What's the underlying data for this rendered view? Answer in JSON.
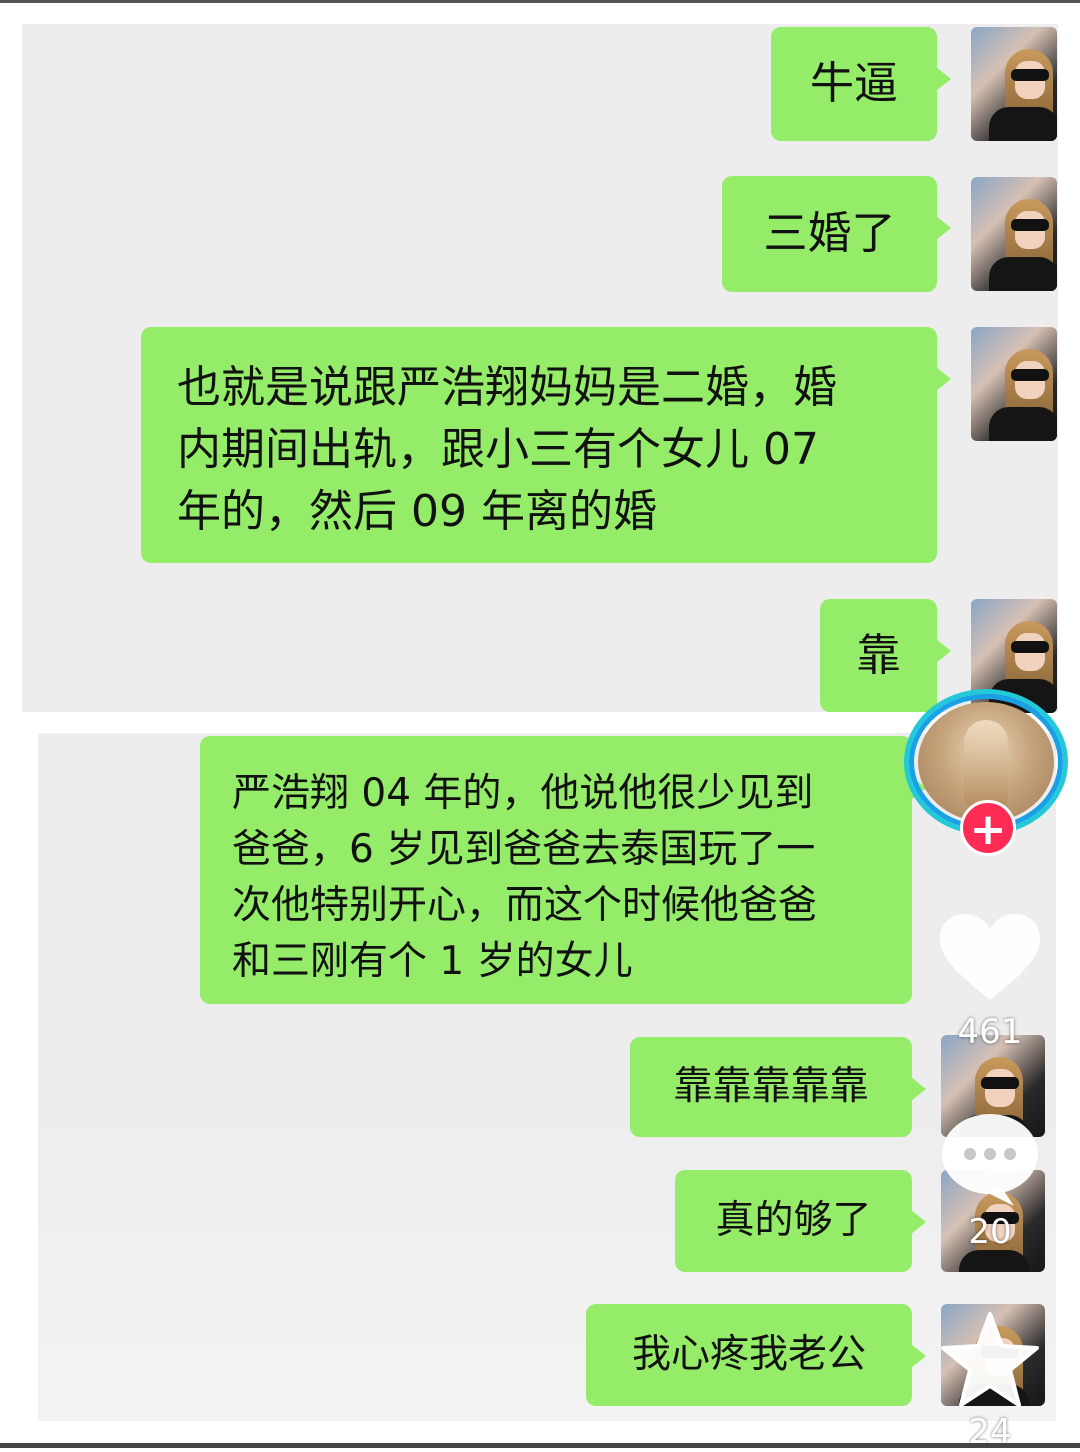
{
  "chat": {
    "messages": [
      {
        "text": "牛逼"
      },
      {
        "text": "三婚了"
      },
      {
        "lines": [
          "也就是说跟严浩翔妈妈是二婚，婚",
          "内期间出轨，跟小三有个女儿 07",
          "年的，然后 09 年离的婚"
        ]
      },
      {
        "text": "靠"
      },
      {
        "lines": [
          "严浩翔 04 年的，他说他很少见到",
          "爸爸，6 岁见到爸爸去泰国玩了一",
          "次他特别开心，而这个时候他爸爸",
          "和三刚有个 1 岁的女儿"
        ]
      },
      {
        "text": "靠靠靠靠靠"
      },
      {
        "text": "真的够了"
      },
      {
        "text": "我心疼我老公"
      }
    ]
  },
  "overlay": {
    "like_count": "461",
    "comment_count": "20",
    "favorite_count": "24",
    "follow_icon": "plus-icon",
    "colors": {
      "bubble": "#95ec69",
      "follow": "#fe2c55",
      "ring": "#23c9d8"
    }
  }
}
